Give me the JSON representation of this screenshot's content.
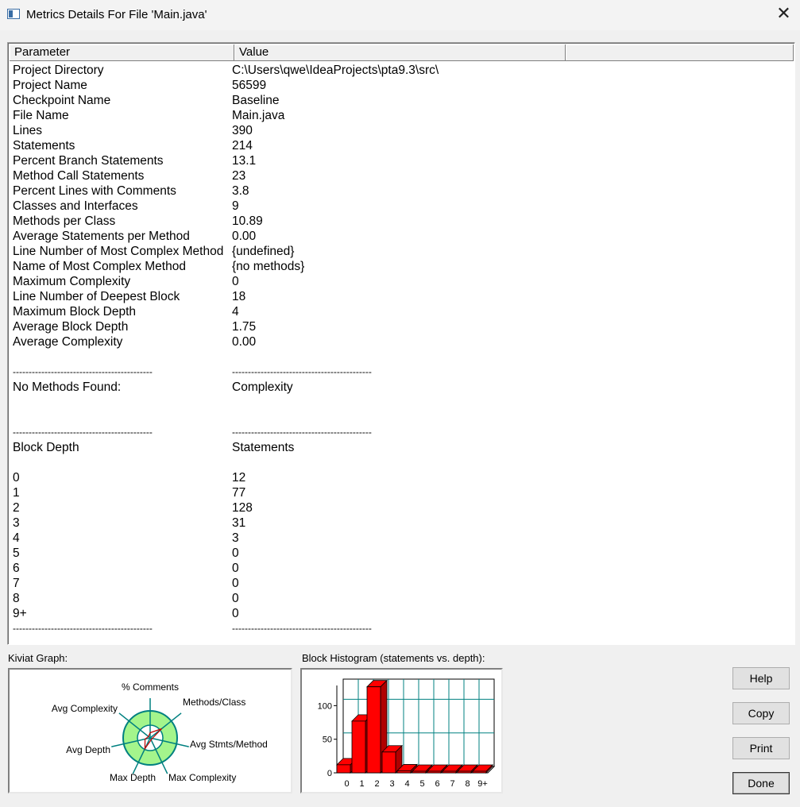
{
  "window": {
    "title": "Metrics Details For File 'Main.java'",
    "close_glyph": "✕"
  },
  "table": {
    "headers": [
      "Parameter",
      "Value",
      ""
    ],
    "rows": [
      [
        "Project Directory",
        "C:\\Users\\qwe\\IdeaProjects\\pta9.3\\src\\"
      ],
      [
        "Project Name",
        "56599"
      ],
      [
        "Checkpoint Name",
        "Baseline"
      ],
      [
        "File Name",
        "Main.java"
      ],
      [
        "Lines",
        "390"
      ],
      [
        "Statements",
        "214"
      ],
      [
        "Percent Branch Statements",
        "13.1"
      ],
      [
        "Method Call Statements",
        "23"
      ],
      [
        "Percent Lines with Comments",
        "3.8"
      ],
      [
        "Classes and Interfaces",
        "9"
      ],
      [
        "Methods per Class",
        "10.89"
      ],
      [
        "Average Statements per Method",
        "0.00"
      ],
      [
        "Line Number of Most Complex Method",
        "{undefined}"
      ],
      [
        "Name of Most Complex Method",
        "{no methods}"
      ],
      [
        "Maximum Complexity",
        "0"
      ],
      [
        "Line Number of Deepest Block",
        "18"
      ],
      [
        "Maximum Block Depth",
        "4"
      ],
      [
        "Average Block Depth",
        "1.75"
      ],
      [
        "Average Complexity",
        "0.00"
      ],
      [
        "",
        ""
      ],
      [
        "--------------------------------------------",
        "--------------------------------------------"
      ],
      [
        "No Methods Found:",
        "Complexity"
      ],
      [
        "",
        ""
      ],
      [
        "",
        ""
      ],
      [
        "--------------------------------------------",
        "--------------------------------------------"
      ],
      [
        "Block Depth",
        "Statements"
      ],
      [
        "",
        ""
      ],
      [
        "0",
        "12"
      ],
      [
        "1",
        "77"
      ],
      [
        "2",
        "128"
      ],
      [
        "3",
        "31"
      ],
      [
        "4",
        "3"
      ],
      [
        "5",
        "0"
      ],
      [
        "6",
        "0"
      ],
      [
        "7",
        "0"
      ],
      [
        "8",
        "0"
      ],
      [
        "9+",
        "0"
      ],
      [
        "--------------------------------------------",
        "--------------------------------------------"
      ]
    ]
  },
  "kiviat": {
    "label": "Kiviat Graph:",
    "axes": [
      "% Comments",
      "Methods/Class",
      "Avg Stmts/Method",
      "Max Complexity",
      "Max Depth",
      "Avg Depth",
      "Avg Complexity"
    ],
    "values": [
      3.8,
      10.89,
      0.0,
      0,
      4,
      1.75,
      0.0
    ],
    "colors": {
      "ring": "#a4f58c",
      "axis": "#008080",
      "plot": "#c00000"
    }
  },
  "histogram": {
    "label": "Block Histogram (statements vs. depth):",
    "bar_color": "#ff0000",
    "grid_color": "#008080"
  },
  "chart_data": {
    "type": "bar",
    "title": "Block Histogram (statements vs. depth):",
    "categories": [
      "0",
      "1",
      "2",
      "3",
      "4",
      "5",
      "6",
      "7",
      "8",
      "9+"
    ],
    "values": [
      12,
      77,
      128,
      31,
      3,
      0,
      0,
      0,
      0,
      0
    ],
    "y_ticks": [
      "0",
      "50",
      "100"
    ],
    "ylim": [
      0,
      130
    ],
    "grid": true
  },
  "buttons": {
    "help": "Help",
    "copy": "Copy",
    "print": "Print",
    "done": "Done"
  }
}
